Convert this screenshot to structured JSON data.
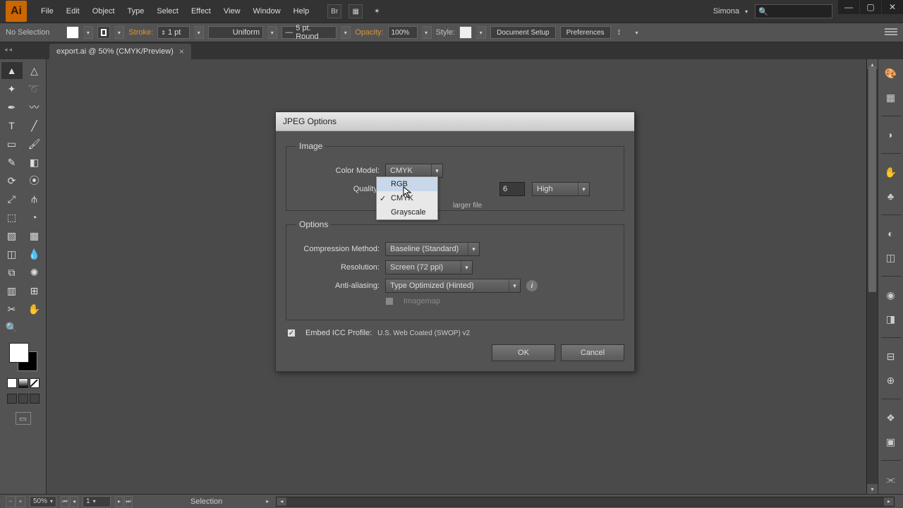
{
  "app": {
    "logo": "Ai"
  },
  "menu": [
    "File",
    "Edit",
    "Object",
    "Type",
    "Select",
    "Effect",
    "View",
    "Window",
    "Help"
  ],
  "user": "Simona",
  "controlbar": {
    "noSelection": "No Selection",
    "stroke": "Stroke:",
    "strokeVal": "1 pt",
    "uniform": "Uniform",
    "brush": "5 pt. Round",
    "opacity": "Opacity:",
    "opacityVal": "100%",
    "style": "Style:",
    "docSetup": "Document Setup",
    "prefs": "Preferences"
  },
  "tab": {
    "name": "export.ai @ 50% (CMYK/Preview)"
  },
  "status": {
    "zoom": "50%",
    "page": "1",
    "tool": "Selection"
  },
  "dialog": {
    "title": "JPEG Options",
    "image": {
      "legend": "Image",
      "colorModelLabel": "Color Model:",
      "colorModelValue": "CMYK",
      "qualityLabel": "Quality:",
      "qualityNum": "6",
      "qualityPreset": "High",
      "largerFile": "larger file"
    },
    "colorOptions": {
      "rgb": "RGB",
      "cmyk": "CMYK",
      "gray": "Grayscale"
    },
    "options": {
      "legend": "Options",
      "compressionLabel": "Compression Method:",
      "compressionValue": "Baseline (Standard)",
      "resolutionLabel": "Resolution:",
      "resolutionValue": "Screen (72 ppi)",
      "aaLabel": "Anti-aliasing:",
      "aaValue": "Type Optimized (Hinted)",
      "imagemap": "Imagemap"
    },
    "embed": {
      "label": "Embed ICC Profile:",
      "profile": "U.S. Web Coated (SWOP) v2"
    },
    "ok": "OK",
    "cancel": "Cancel"
  }
}
